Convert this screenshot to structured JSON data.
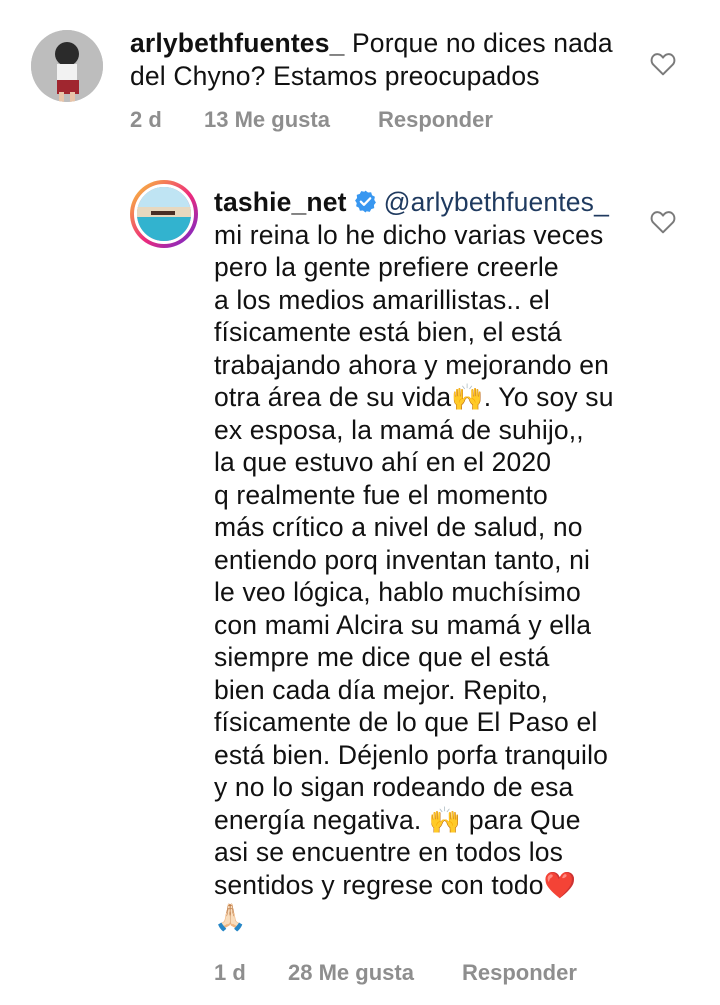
{
  "comments": [
    {
      "username": "arlybethfuentes_",
      "text": "Porque no dices nada del Chyno? Estamos preocupados",
      "time": "2 d",
      "likes": "13 Me gusta",
      "reply": "Responder"
    },
    {
      "username": "tashie_net",
      "mention": "@arlybethfuentes_",
      "lines": [
        "mi reina lo he dicho varias veces",
        "pero la gente prefiere creerle",
        "a los medios amarillistas.. el",
        "físicamente está bien, el está",
        "trabajando ahora y mejorando en",
        "otra área de su vida",
        ". Yo soy su",
        "ex esposa, la mamá de suhijo,,",
        "la que estuvo ahí en el 2020",
        "q realmente fue el momento",
        "más crítico a nivel de salud, no",
        "entiendo porq inventan tanto, ni",
        "le veo lógica, hablo muchísimo",
        "con mami Alcira su mamá y ella",
        "siempre me dice que el está",
        "bien cada día mejor. Repito,",
        "físicamente de lo que El Paso el",
        "está bien. Déjenlo porfa tranquilo",
        "y no lo sigan rodeando de esa",
        "energía negativa.",
        "para Que",
        "asi se encuentre en todos los",
        "sentidos y regrese con todo"
      ],
      "emoji_raised_hands": "🙌",
      "emoji_heart": "❤️",
      "emoji_pray": "🙏🏻",
      "time": "1 d",
      "likes": "28 Me gusta",
      "reply": "Responder"
    }
  ],
  "icons": {
    "like": "heart-outline-icon",
    "verified": "verified-badge-icon"
  },
  "colors": {
    "meta": "#8e8e8e",
    "verified": "#3897f0",
    "mention": "#1f3a5f"
  }
}
